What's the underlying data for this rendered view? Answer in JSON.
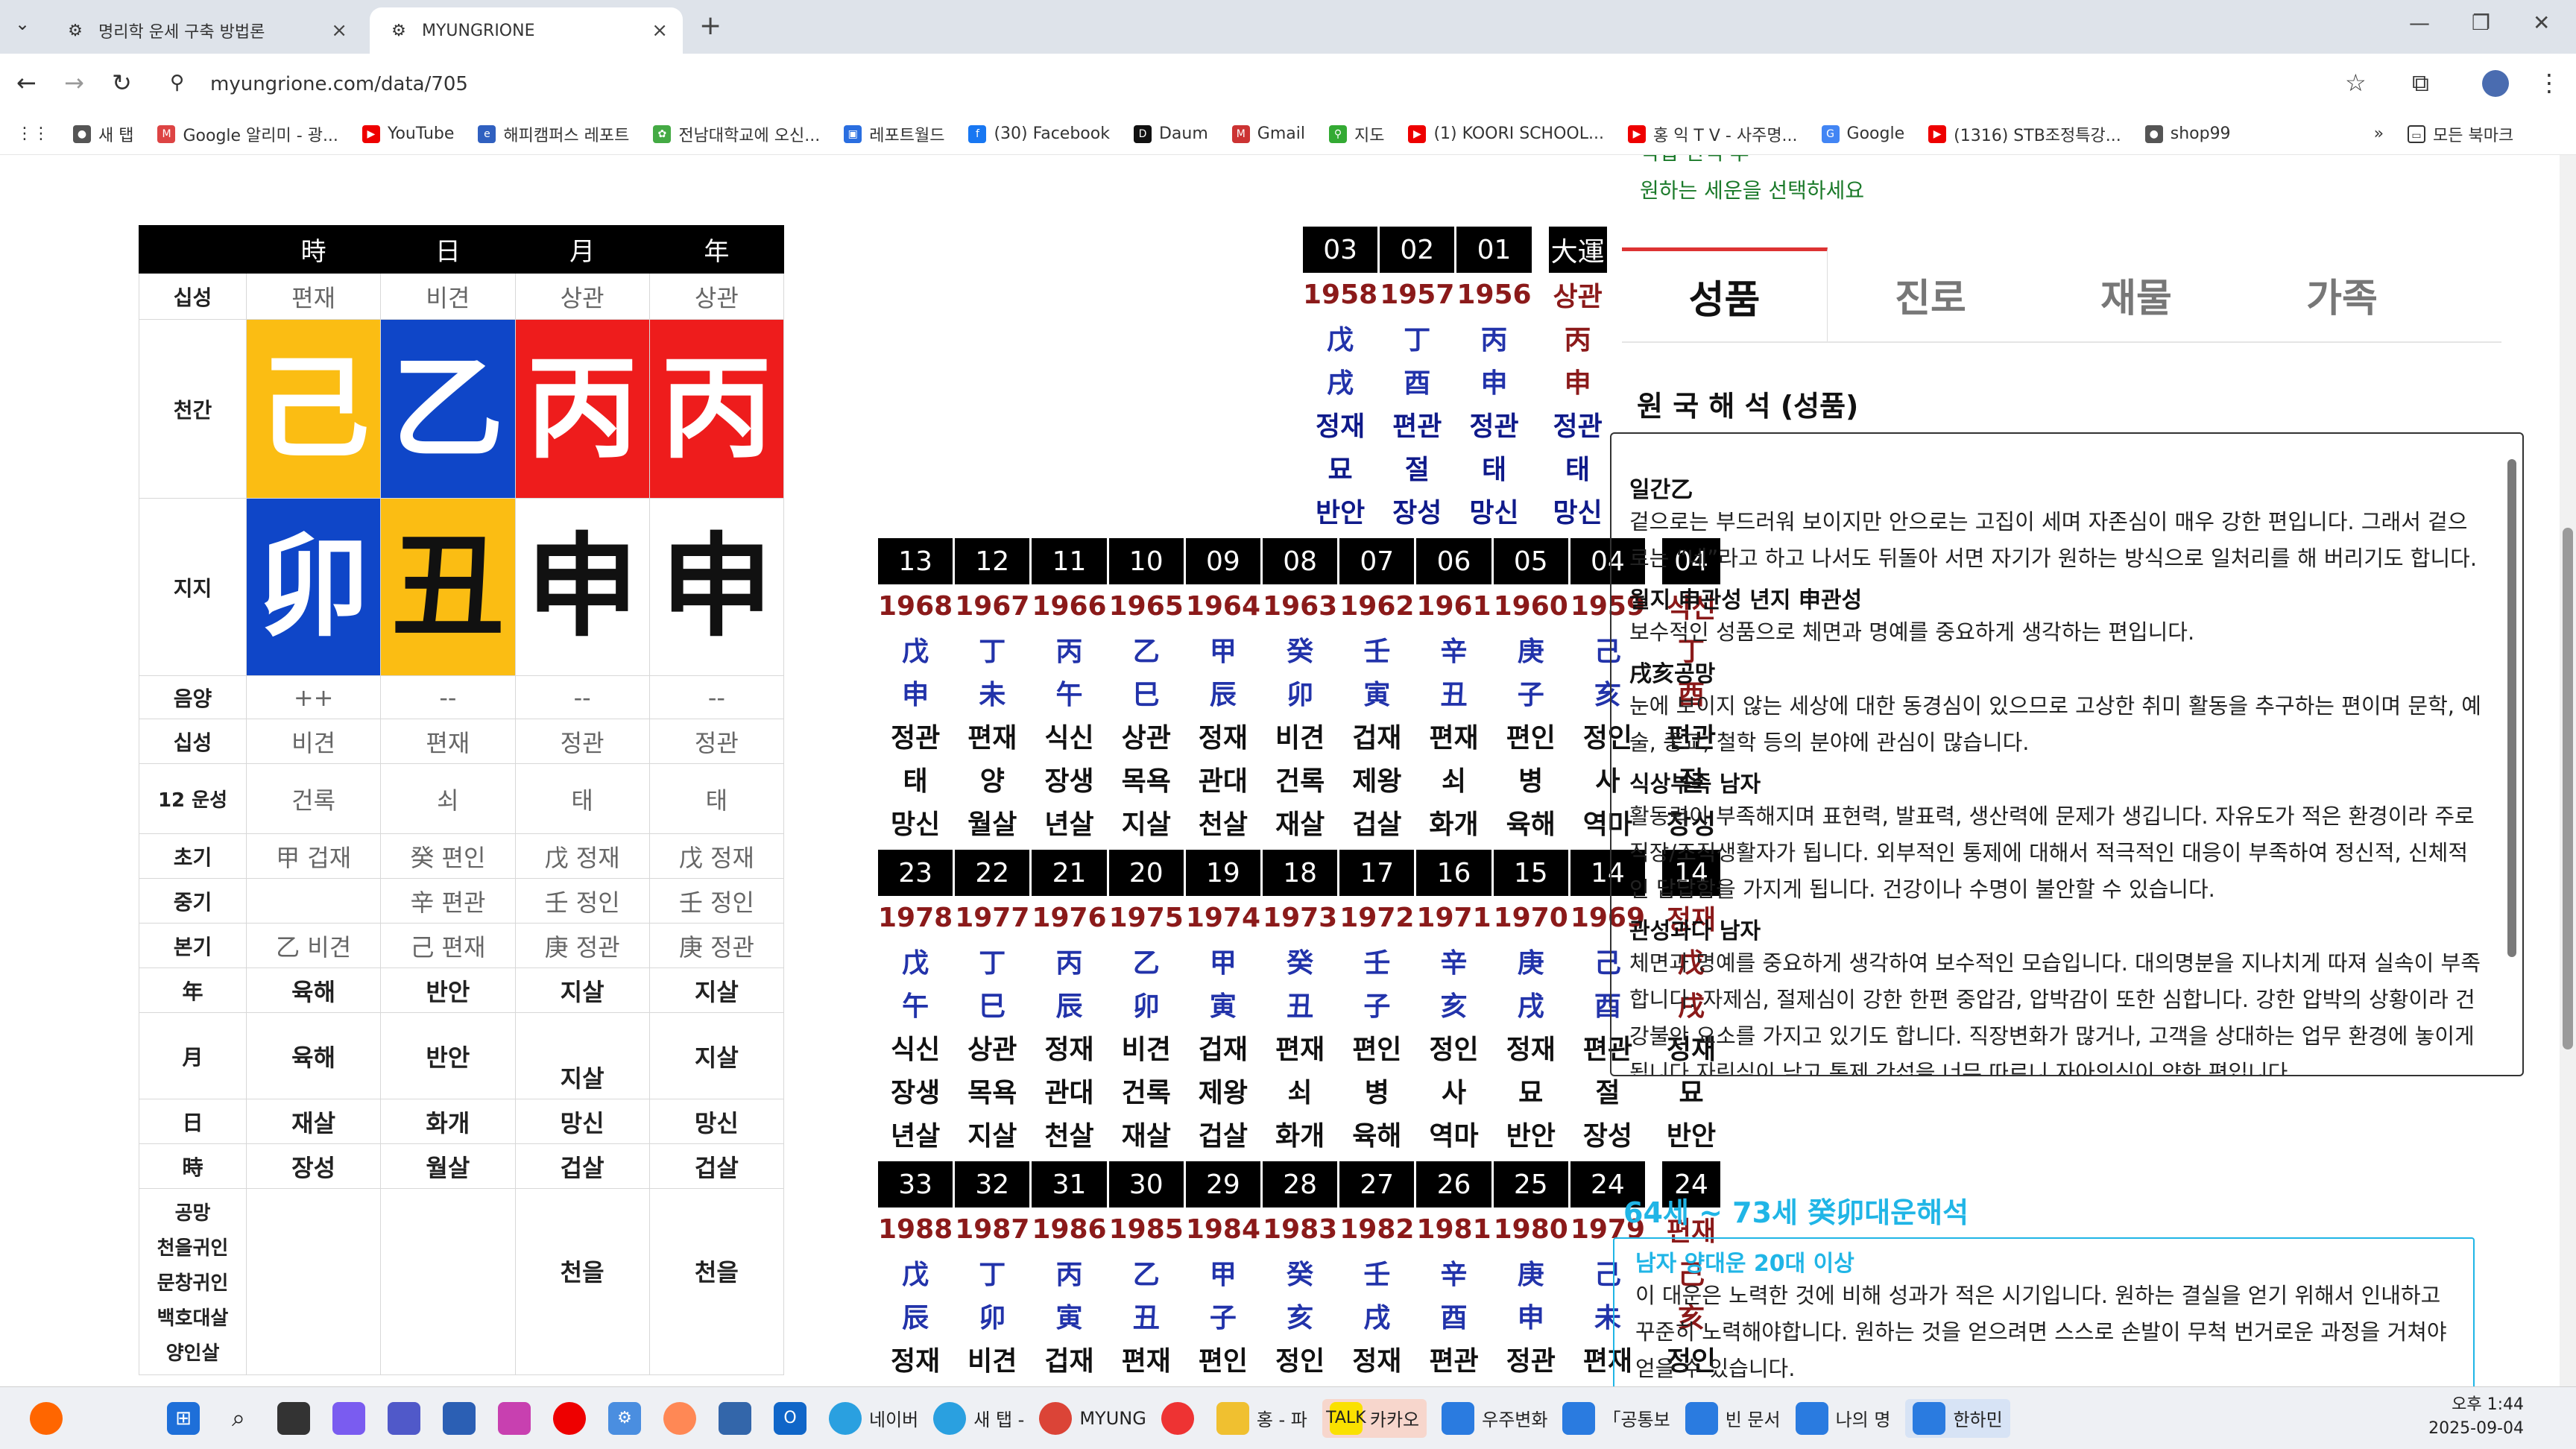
{
  "browser": {
    "tabs": [
      {
        "title": "명리학 운세 구축 방법론"
      },
      {
        "title": "MYUNGRIONE"
      }
    ],
    "url": "myungrione.com/data/705",
    "bookmarks": [
      "새 탭",
      "Google 알리미 - 광...",
      "YouTube",
      "해피캠퍼스 레포트",
      "전남대학교에 오신...",
      "레포트월드",
      "(30) Facebook",
      "Daum",
      "Gmail",
      "지도",
      "(1) KOORI SCHOOL...",
      "홍 익 T V - 사주명...",
      "Google",
      "(1316) STB조정특강...",
      "shop99"
    ],
    "all_bookmarks": "모든 북마크"
  },
  "saju": {
    "headers": [
      "時",
      "日",
      "月",
      "年"
    ],
    "rows": [
      {
        "label": "십성",
        "cells": [
          "편재",
          "비견",
          "상관",
          "상관"
        ]
      },
      {
        "label": "천간",
        "cells": [
          "己",
          "乙",
          "丙",
          "丙"
        ]
      },
      {
        "label": "지지",
        "cells": [
          "卯",
          "丑",
          "申",
          "申"
        ]
      },
      {
        "label": "음양",
        "cells": [
          "++",
          "--",
          "--",
          "--"
        ]
      },
      {
        "label": "십성",
        "cells": [
          "비견",
          "편재",
          "정관",
          "정관"
        ]
      },
      {
        "label": "12 운성",
        "cells": [
          "건록",
          "쇠",
          "태",
          "태"
        ]
      },
      {
        "label": "초기",
        "cells": [
          "甲 겁재",
          "癸 편인",
          "戊 정재",
          "戊 정재"
        ]
      },
      {
        "label": "중기",
        "cells": [
          "",
          "辛 편관",
          "壬 정인",
          "壬 정인"
        ]
      },
      {
        "label": "본기",
        "cells": [
          "乙 비견",
          "己 편재",
          "庚 정관",
          "庚 정관"
        ]
      },
      {
        "label": "年",
        "cells": [
          "육해",
          "반안",
          "지살",
          "지살"
        ]
      },
      {
        "label": "月",
        "cells": [
          "육해",
          "반안",
          "지살",
          "지살"
        ]
      },
      {
        "label": "日",
        "cells": [
          "재살",
          "화개",
          "망신",
          "망신"
        ]
      },
      {
        "label": "時",
        "cells": [
          "장성",
          "월살",
          "겁살",
          "겁살"
        ]
      }
    ],
    "extra_label": [
      "공망",
      "천을귀인",
      "문창귀인",
      "백호대살",
      "양인살"
    ],
    "extra_cells": [
      "",
      "",
      "천을",
      "천을"
    ]
  },
  "daeun": {
    "top": {
      "nums": [
        "03",
        "02",
        "01"
      ],
      "years": [
        "1958",
        "1957",
        "1956"
      ],
      "gan": [
        "戊",
        "丁",
        "丙"
      ],
      "ji": [
        "戌",
        "酉",
        "申"
      ],
      "ss": [
        "정재",
        "편관",
        "정관"
      ],
      "un": [
        "묘",
        "절",
        "태"
      ],
      "sal": [
        "반안",
        "장성",
        "망신"
      ],
      "side": {
        "num": "大運",
        "ss": "상관",
        "gan": "丙",
        "ji": "申",
        "ss2": "정관",
        "un": "태",
        "sal": "망신"
      }
    },
    "blocks": [
      {
        "nums": [
          "13",
          "12",
          "11",
          "10",
          "09",
          "08",
          "07",
          "06",
          "05",
          "04"
        ],
        "years": [
          "1968",
          "1967",
          "1966",
          "1965",
          "1964",
          "1963",
          "1962",
          "1961",
          "1960",
          "1959"
        ],
        "gan": [
          "戊",
          "丁",
          "丙",
          "乙",
          "甲",
          "癸",
          "壬",
          "辛",
          "庚",
          "己"
        ],
        "ji": [
          "申",
          "未",
          "午",
          "巳",
          "辰",
          "卯",
          "寅",
          "丑",
          "子",
          "亥"
        ],
        "ss": [
          "정관",
          "편재",
          "식신",
          "상관",
          "정재",
          "비견",
          "겁재",
          "편재",
          "편인",
          "정인"
        ],
        "un": [
          "태",
          "양",
          "장생",
          "목욕",
          "관대",
          "건록",
          "제왕",
          "쇠",
          "병",
          "사"
        ],
        "sal": [
          "망신",
          "월살",
          "년살",
          "지살",
          "천살",
          "재살",
          "겁살",
          "화개",
          "육해",
          "역마"
        ],
        "side": {
          "num": "04",
          "ss": "식신",
          "gan": "丁",
          "ji": "酉",
          "ss2": "편관",
          "un": "절",
          "sal": "장성"
        }
      },
      {
        "nums": [
          "23",
          "22",
          "21",
          "20",
          "19",
          "18",
          "17",
          "16",
          "15",
          "14"
        ],
        "years": [
          "1978",
          "1977",
          "1976",
          "1975",
          "1974",
          "1973",
          "1972",
          "1971",
          "1970",
          "1969"
        ],
        "gan": [
          "戊",
          "丁",
          "丙",
          "乙",
          "甲",
          "癸",
          "壬",
          "辛",
          "庚",
          "己"
        ],
        "ji": [
          "午",
          "巳",
          "辰",
          "卯",
          "寅",
          "丑",
          "子",
          "亥",
          "戌",
          "酉"
        ],
        "ss": [
          "식신",
          "상관",
          "정재",
          "비견",
          "겁재",
          "편재",
          "편인",
          "정인",
          "정재",
          "편관"
        ],
        "un": [
          "장생",
          "목욕",
          "관대",
          "건록",
          "제왕",
          "쇠",
          "병",
          "사",
          "묘",
          "절"
        ],
        "sal": [
          "년살",
          "지살",
          "천살",
          "재살",
          "겁살",
          "화개",
          "육해",
          "역마",
          "반안",
          "장성"
        ],
        "side": {
          "num": "14",
          "ss": "정재",
          "gan": "戊",
          "ji": "戌",
          "ss2": "정재",
          "un": "묘",
          "sal": "반안"
        }
      },
      {
        "nums": [
          "33",
          "32",
          "31",
          "30",
          "29",
          "28",
          "27",
          "26",
          "25",
          "24"
        ],
        "years": [
          "1988",
          "1987",
          "1986",
          "1985",
          "1984",
          "1983",
          "1982",
          "1981",
          "1980",
          "1979"
        ],
        "gan": [
          "戊",
          "丁",
          "丙",
          "乙",
          "甲",
          "癸",
          "壬",
          "辛",
          "庚",
          "己"
        ],
        "ji": [
          "辰",
          "卯",
          "寅",
          "丑",
          "子",
          "亥",
          "戌",
          "酉",
          "申",
          "未"
        ],
        "ss": [
          "정재",
          "비견",
          "겁재",
          "편재",
          "편인",
          "정인",
          "정재",
          "편관",
          "정관",
          "편재"
        ],
        "side": {
          "num": "24",
          "ss": "편재",
          "gan": "己",
          "ji": "亥",
          "ss2": "정인"
        }
      }
    ]
  },
  "panel": {
    "top_partial_1": "직업 선택 후",
    "top_line": "원하는 세운을 선택하세요",
    "tabs": [
      "성품",
      "진로",
      "재물",
      "가족"
    ],
    "section_title": "원 국 해 석 (성품)",
    "items": [
      {
        "h": "일간乙",
        "p": "겉으로는 부드러워 보이지만 안으로는 고집이 세며 자존심이 매우 강한 편입니다. 그래서 겉으로는 “네”라고 하고 나서도 뒤돌아 서면 자기가 원하는 방식으로 일처리를 해 버리기도 합니다."
      },
      {
        "h": "월지 申관성 년지 申관성",
        "p": "보수적인 성품으로 체면과 명예를 중요하게 생각하는 편입니다."
      },
      {
        "h": "戌亥공망",
        "p": "눈에 보이지 않는 세상에 대한 동경심이 있으므로 고상한 취미 활동을 추구하는 편이며 문학, 예술, 종교, 철학 등의 분야에 관심이 많습니다."
      },
      {
        "h": "식상부족 남자",
        "p": "활동력이 부족해지며 표현력, 발표력, 생산력에 문제가 생깁니다. 자유도가 적은 환경이라 주로 직장/조직생활자가 됩니다. 외부적인 통제에 대해서 적극적인 대응이 부족하여 정신적, 신체적인 답답함을 가지게 됩니다. 건강이나 수명이 불안할 수 있습니다."
      },
      {
        "h": "관성과다 남자",
        "p": "체면과 명예를 중요하게 생각하여 보수적인 모습입니다. 대의명분을 지나치게 따져 실속이 부족합니다. 자제심, 절제심이 강한 한편 중압감, 압박감이 또한 심합니다. 강한 압박의 상황이라 건강불안 요소를 가지고 있기도 합니다. 직장변화가 많거나, 고객을 상대하는 업무 환경에 놓이게 됩니다 자린심이 낮고 통제 간섭을 너무 따르니 자아의식이 약한 편입니다."
      }
    ],
    "daeun_title": "64세 ~ 73세 癸卯대운해석",
    "daeun_h": "남자 양대운 20대 이상",
    "daeun_p": "이 대운은 노력한 것에 비해 성과가 적은 시기입니다. 원하는 결실을 얻기 위해서 인내하고 꾸준히 노력해야합니다. 원하는 것을 얻으려면 스스로 손발이 무척 번거로운 과정을 거쳐야 얻을 수 있습니다."
  },
  "taskbar": {
    "items": [
      "네이버",
      "새 탭 -",
      "MYUNG",
      "",
      "홍 - 파",
      "카카오",
      "우주변화",
      "「공통보",
      "빈 문서",
      "나의 명",
      "한하민"
    ],
    "time": "오후 1:44",
    "date": "2025-09-04"
  }
}
